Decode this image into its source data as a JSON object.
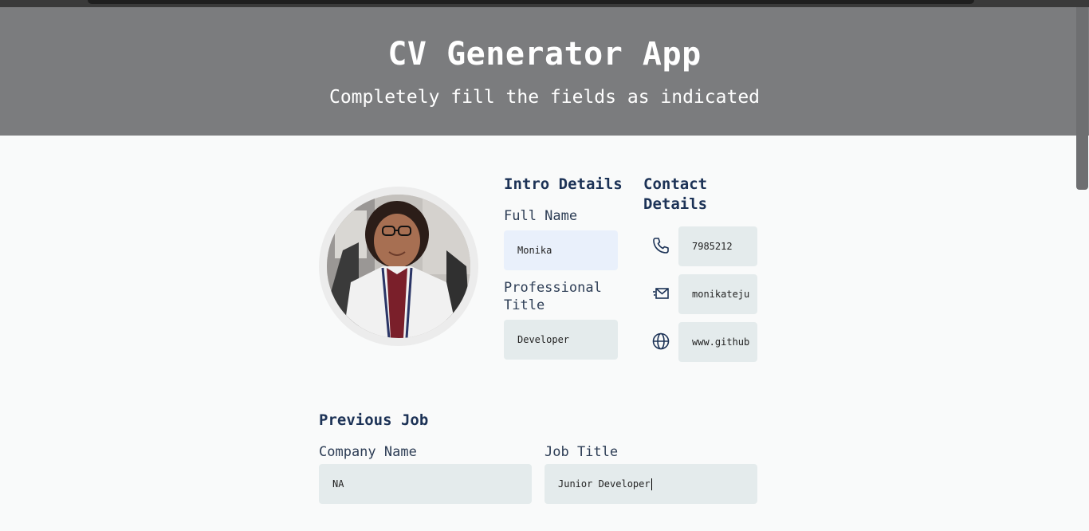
{
  "header": {
    "title": "CV Generator App",
    "subtitle": "Completely fill the fields as indicated"
  },
  "intro": {
    "heading": "Intro Details",
    "full_name_label": "Full Name",
    "full_name_value": "Monika",
    "title_label": "Professional Title",
    "title_value": "Developer"
  },
  "contact": {
    "heading": "Contact Details",
    "phone_value": "7985212",
    "email_value": "monikateju",
    "website_value": "www.github",
    "phone_icon": "phone-icon",
    "email_icon": "mail-icon",
    "website_icon": "globe-icon"
  },
  "previous_job": {
    "heading": "Previous Job",
    "company_label": "Company Name",
    "company_value": "NA",
    "job_title_label": "Job Title",
    "job_title_value": "Junior Developer"
  },
  "colors": {
    "header_bg": "#7b7c7e",
    "heading_text": "#1c3256",
    "field_bg": "#e4ebec",
    "active_field_bg": "#e9f0fb"
  }
}
